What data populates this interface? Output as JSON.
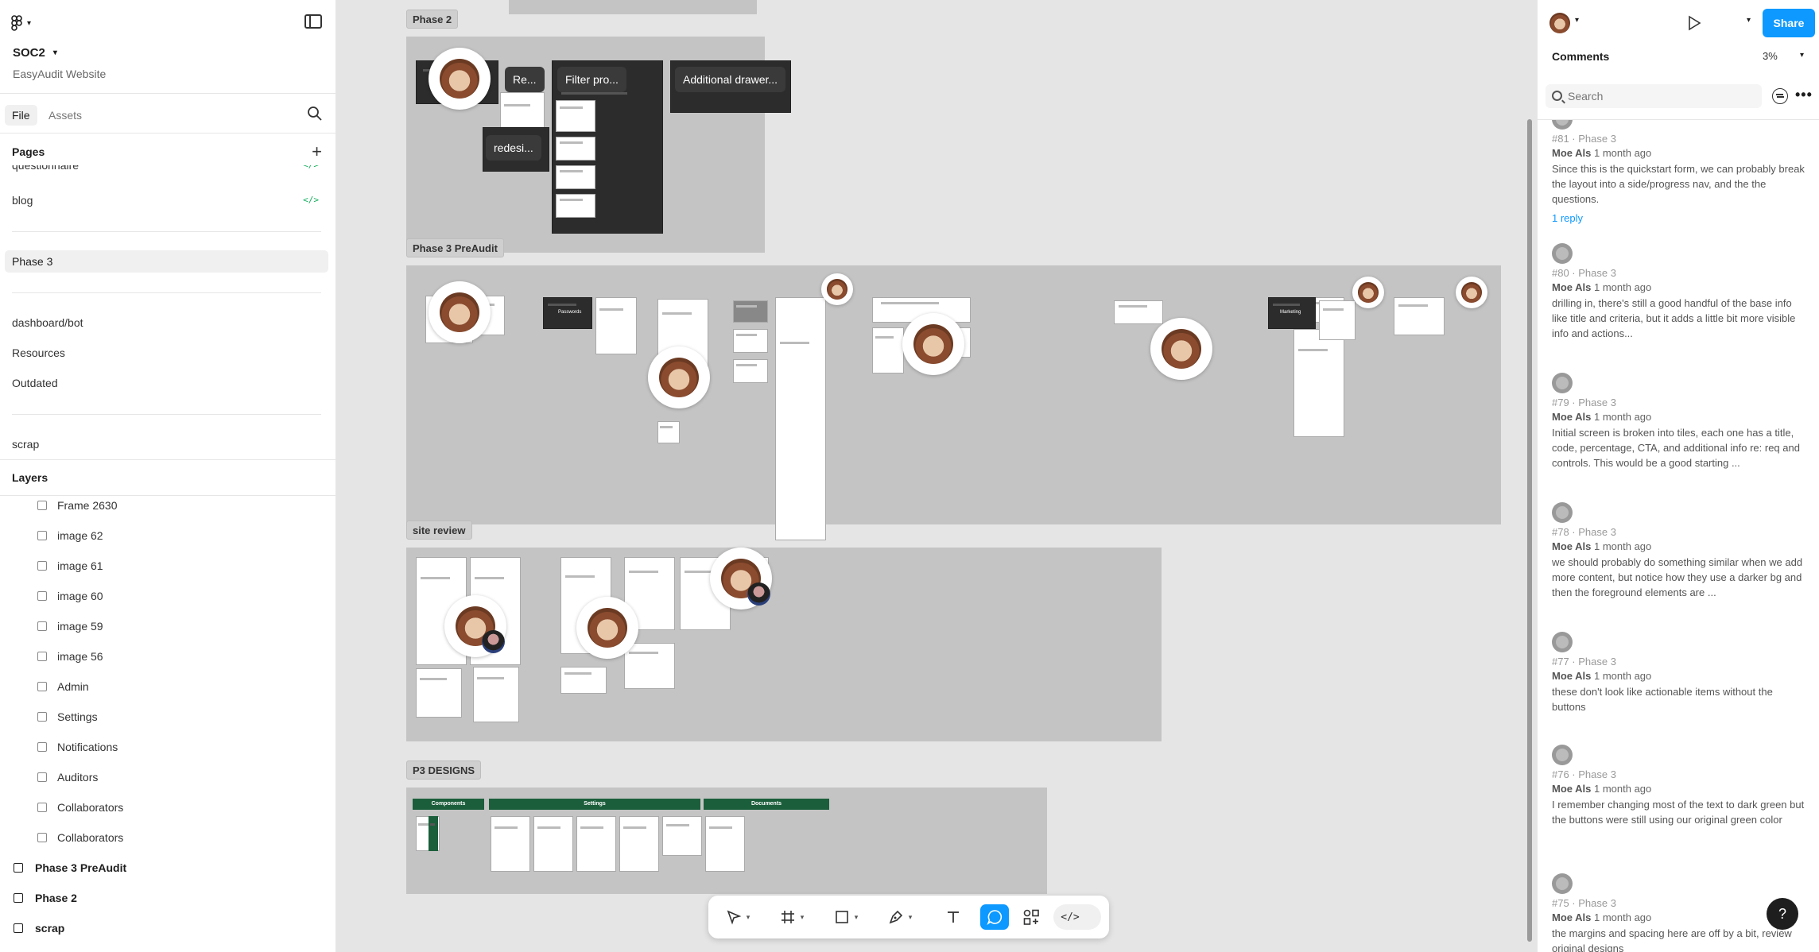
{
  "file": {
    "name": "SOC2",
    "project": "EasyAudit Website"
  },
  "left_tabs": {
    "file": "File",
    "assets": "Assets"
  },
  "pages": {
    "title": "Pages",
    "items": [
      {
        "label": "questionnaire",
        "code": "</>"
      },
      {
        "label": "blog",
        "code": "</>"
      },
      {
        "label": "Phase 3"
      },
      {
        "label": "dashboard/bot"
      },
      {
        "label": "Resources"
      },
      {
        "label": "Outdated"
      },
      {
        "label": "scrap"
      }
    ]
  },
  "layers": {
    "title": "Layers",
    "items": [
      {
        "label": "Frame 2630",
        "icon": "frame-icon"
      },
      {
        "label": "image 62",
        "icon": "image-icon"
      },
      {
        "label": "image 61",
        "icon": "image-icon"
      },
      {
        "label": "image 60",
        "icon": "image-icon"
      },
      {
        "label": "image 59",
        "icon": "image-icon"
      },
      {
        "label": "image 56",
        "icon": "image-icon"
      },
      {
        "label": "Admin",
        "icon": "frame-icon"
      },
      {
        "label": "Settings",
        "icon": "frame-icon"
      },
      {
        "label": "Notifications",
        "icon": "frame-icon"
      },
      {
        "label": "Auditors",
        "icon": "frame-icon"
      },
      {
        "label": "Collaborators",
        "icon": "frame-icon"
      },
      {
        "label": "Collaborators",
        "icon": "frame-icon"
      },
      {
        "label": "Phase 3 PreAudit",
        "icon": "section-icon"
      },
      {
        "label": "Phase 2",
        "icon": "section-icon"
      },
      {
        "label": "scrap",
        "icon": "section-icon"
      }
    ]
  },
  "canvas": {
    "sections": {
      "phase2": "Phase 2",
      "phase3": "Phase 3 PreAudit",
      "site_review": "site review",
      "p3_designs": "P3 DESIGNS"
    },
    "phase2_labels": [
      "Re...",
      "Filter pro...",
      "Additional drawer...",
      "redesi..."
    ],
    "phase3_labels": [
      "Passwords",
      "Marketing"
    ],
    "p3_bars": [
      "Components",
      "Settings",
      "Documents"
    ]
  },
  "toolbar": {
    "dev_mode": "</>"
  },
  "right_panel": {
    "share_label": "Share",
    "title": "Comments",
    "zoom": "3%",
    "search_placeholder": "Search",
    "comments": [
      {
        "id": "#81 · Phase 3",
        "author": "Moe Als",
        "time": "1 month ago",
        "body": "Since this is the quickstart form, we can probably break the layout into a side/progress nav, and the the questions.",
        "reply": "1 reply"
      },
      {
        "id": "#80 · Phase 3",
        "author": "Moe Als",
        "time": "1 month ago",
        "body": "drilling in, there's still a good handful of the base info like title and criteria, but it adds a little bit more visible info and actions..."
      },
      {
        "id": "#79 · Phase 3",
        "author": "Moe Als",
        "time": "1 month ago",
        "body": "Initial screen is broken into tiles, each one has a title, code, percentage, CTA, and additional info re: req and controls. This would be a good starting ..."
      },
      {
        "id": "#78 · Phase 3",
        "author": "Moe Als",
        "time": "1 month ago",
        "body": "we should probably do something similar when we add  more content, but notice how they use a darker bg and then the foreground elements are ..."
      },
      {
        "id": "#77 · Phase 3",
        "author": "Moe Als",
        "time": "1 month ago",
        "body": "these don't look like actionable items without the buttons"
      },
      {
        "id": "#76 · Phase 3",
        "author": "Moe Als",
        "time": "1 month ago",
        "body": "I remember changing most of the text to dark green but the buttons were still using our original green color"
      },
      {
        "id": "#75 · Phase 3",
        "author": "Moe Als",
        "time": "1 month ago",
        "body": "the margins and spacing here are off by a bit, review original designs"
      }
    ]
  },
  "help_label": "?",
  "colors": {
    "accent": "#0d99ff",
    "brand_green": "#1b5e3b",
    "dev_green": "#14ae5c"
  }
}
